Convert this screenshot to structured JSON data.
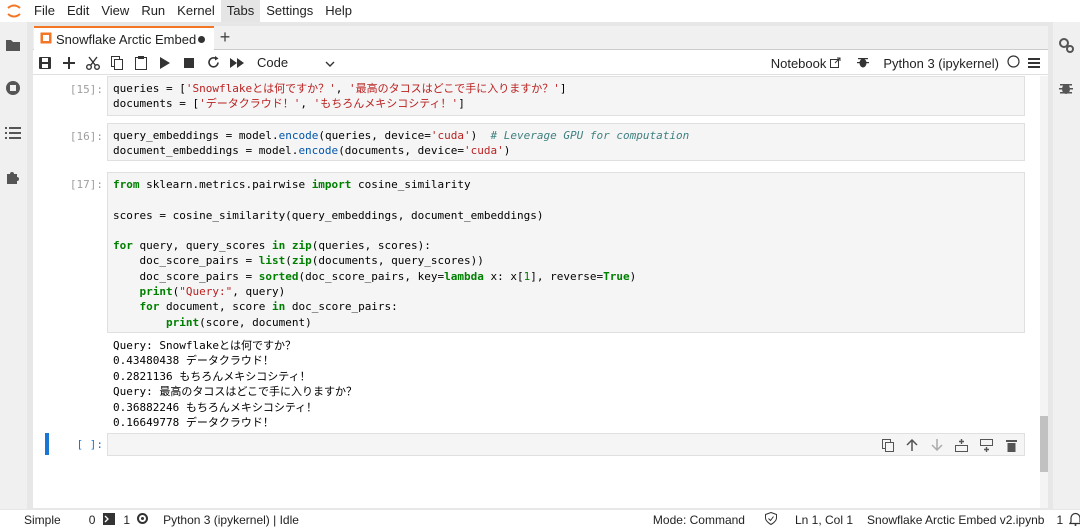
{
  "menu": {
    "items": [
      "File",
      "Edit",
      "View",
      "Run",
      "Kernel",
      "Tabs",
      "Settings",
      "Help"
    ]
  },
  "tab": {
    "title": "Snowflake Arctic Embed v2.ipynb",
    "new_tab_label": "+"
  },
  "toolbar": {
    "cell_type": "Code",
    "notebook_label": "Notebook",
    "kernel_label": "Python 3 (ipykernel)"
  },
  "cells": {
    "c15": {
      "prompt": "[15]:",
      "lines": [
        "queries = ['Snowflakeとは何ですか？', '最高のタコスはどこで手に入りますか？']",
        "documents = ['データクラウド！', 'もちろんメキシコシティ！']"
      ]
    },
    "c16": {
      "prompt": "[16]:",
      "lines": [
        "query_embeddings = model.encode(queries, device='cuda')  # Leverage GPU for computation",
        "document_embeddings = model.encode(documents, device='cuda')"
      ]
    },
    "c17": {
      "prompt": "[17]:",
      "lines": [
        "from sklearn.metrics.pairwise import cosine_similarity",
        "",
        "scores = cosine_similarity(query_embeddings, document_embeddings)",
        "",
        "for query, query_scores in zip(queries, scores):",
        "    doc_score_pairs = list(zip(documents, query_scores))",
        "    doc_score_pairs = sorted(doc_score_pairs, key=lambda x: x[1], reverse=True)",
        "    print(\"Query:\", query)",
        "    for document, score in doc_score_pairs:",
        "        print(score, document)"
      ],
      "output": [
        "Query: Snowflakeとは何ですか？",
        "0.43480438 データクラウド！",
        "0.2821136 もちろんメキシコシティ！",
        "Query: 最高のタコスはどこで手に入りますか？",
        "0.36882246 もちろんメキシコシティ！",
        "0.16649778 データクラウド！"
      ]
    },
    "empty": {
      "prompt": "[ ]:"
    }
  },
  "status": {
    "mode_simple": "Simple",
    "terminals": "0",
    "kernels": "1",
    "kernel_status": "Python 3 (ipykernel) | Idle",
    "mode": "Mode: Command",
    "cursor": "Ln 1, Col 1",
    "filename": "Snowflake Arctic Embed v2.ipynb",
    "notifications": "1"
  },
  "colors": {
    "accent": "#f37626",
    "active_cell": "#1976d2"
  }
}
